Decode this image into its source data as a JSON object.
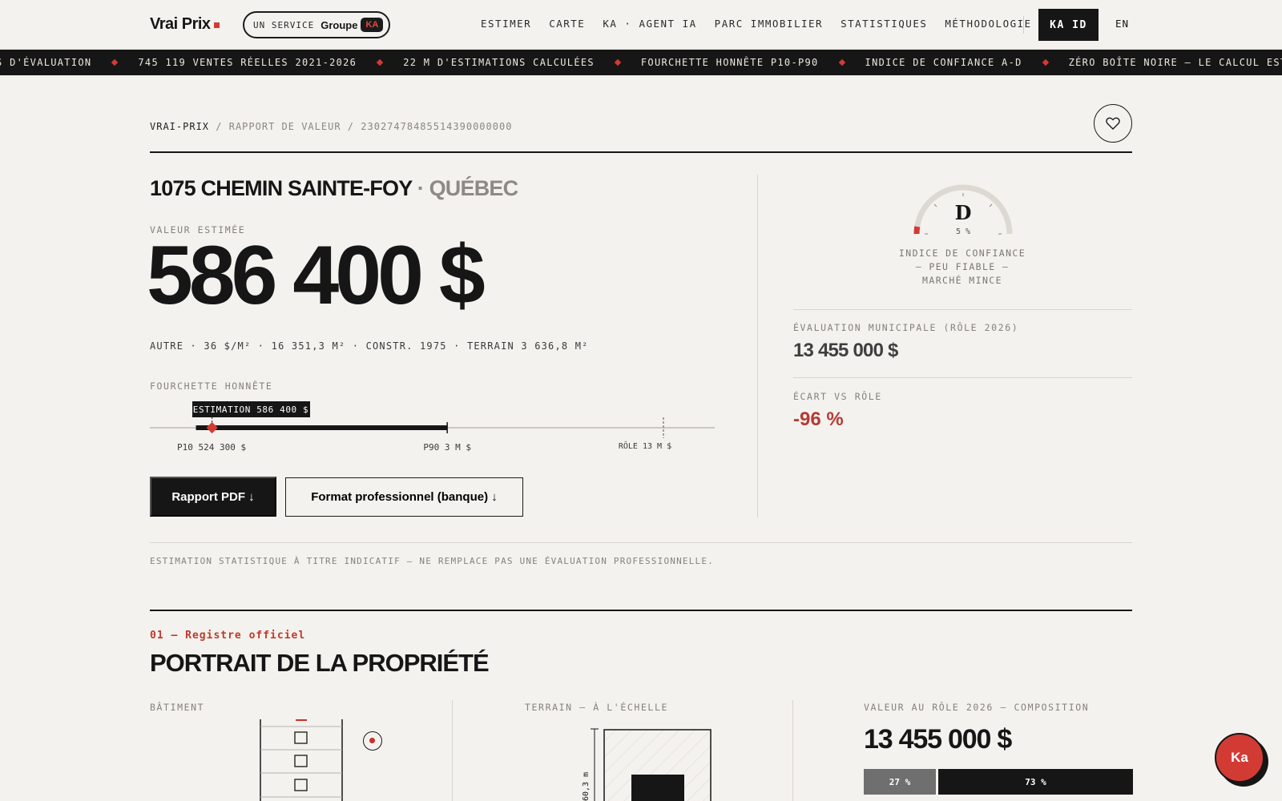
{
  "header": {
    "logo": "Vrai Prix",
    "service_label": "UN SERVICE",
    "service_group": "Groupe",
    "service_badge": "KA",
    "nav": [
      "ESTIMER",
      "CARTE",
      "KA · AGENT IA",
      "PARC IMMOBILIER",
      "STATISTIQUES",
      "MÉTHODOLOGIE"
    ],
    "account_button": "KA ID",
    "language": "EN"
  },
  "ticker": [
    "TÉS D'ÉVALUATION",
    "745 119 VENTES RÉELLES 2021-2026",
    "22 M D'ESTIMATIONS CALCULÉES",
    "FOURCHETTE HONNÊTE P10-P90",
    "INDICE DE CONFIANCE A-D",
    "ZÉRO BOÎTE NOIRE — LE CALCUL EST MONTRÉ"
  ],
  "breadcrumb": {
    "home": "VRAI-PRIX",
    "sep": "/",
    "section": "RAPPORT DE VALEUR",
    "id": "23027478485514390000000"
  },
  "property": {
    "address": "1075 CHEMIN SAINTE-FOY",
    "city": "· QUÉBEC",
    "value_label": "VALEUR ESTIMÉE",
    "value": "586 400 $",
    "meta": "AUTRE · 36 $/M² · 16 351,3 M² · CONSTR. 1975 · TERRAIN 3 636,8 M²"
  },
  "range": {
    "label": "FOURCHETTE HONNÊTE",
    "estimate_tag": "ESTIMATION 586 400 $",
    "p10_label": "P10 524 300 $",
    "p90_label": "P90 3 M $",
    "role_label": "RÔLE 13 M $",
    "estimate_value": 586400,
    "p10_value": 524300,
    "p90_value": 3000000,
    "role_value": 13455000
  },
  "buttons": {
    "pdf": "Rapport PDF ↓",
    "pro": "Format professionnel (banque) ↓"
  },
  "confidence": {
    "grade": "D",
    "percent": "5 %",
    "level": 0.05,
    "line1": "INDICE DE CONFIANCE",
    "line2": "— PEU FIABLE —",
    "line3": "MARCHÉ MINCE",
    "accent": "#d23b34"
  },
  "municipal": {
    "label": "ÉVALUATION MUNICIPALE (RÔLE 2026)",
    "value": "13 455 000 $"
  },
  "ecart": {
    "label": "ÉCART VS RÔLE",
    "value": "-96 %"
  },
  "disclaimer": "ESTIMATION STATISTIQUE À TITRE INDICATIF — NE REMPLACE PAS UNE ÉVALUATION PROFESSIONNELLE.",
  "section": {
    "kicker": "01 — Registre officiel",
    "title": "PORTRAIT DE LA PROPRIÉTÉ",
    "building_label": "BÂTIMENT",
    "terrain_label": "TERRAIN — À L'ÉCHELLE",
    "terrain_dim": "60,3 m",
    "composition_label": "VALEUR AU RÔLE 2026 — COMPOSITION",
    "composition_value": "13 455 000 $",
    "composition": [
      {
        "label": "27 %",
        "share": 27
      },
      {
        "label": "73 %",
        "share": 73
      }
    ]
  },
  "chat": {
    "label": "Ka"
  }
}
